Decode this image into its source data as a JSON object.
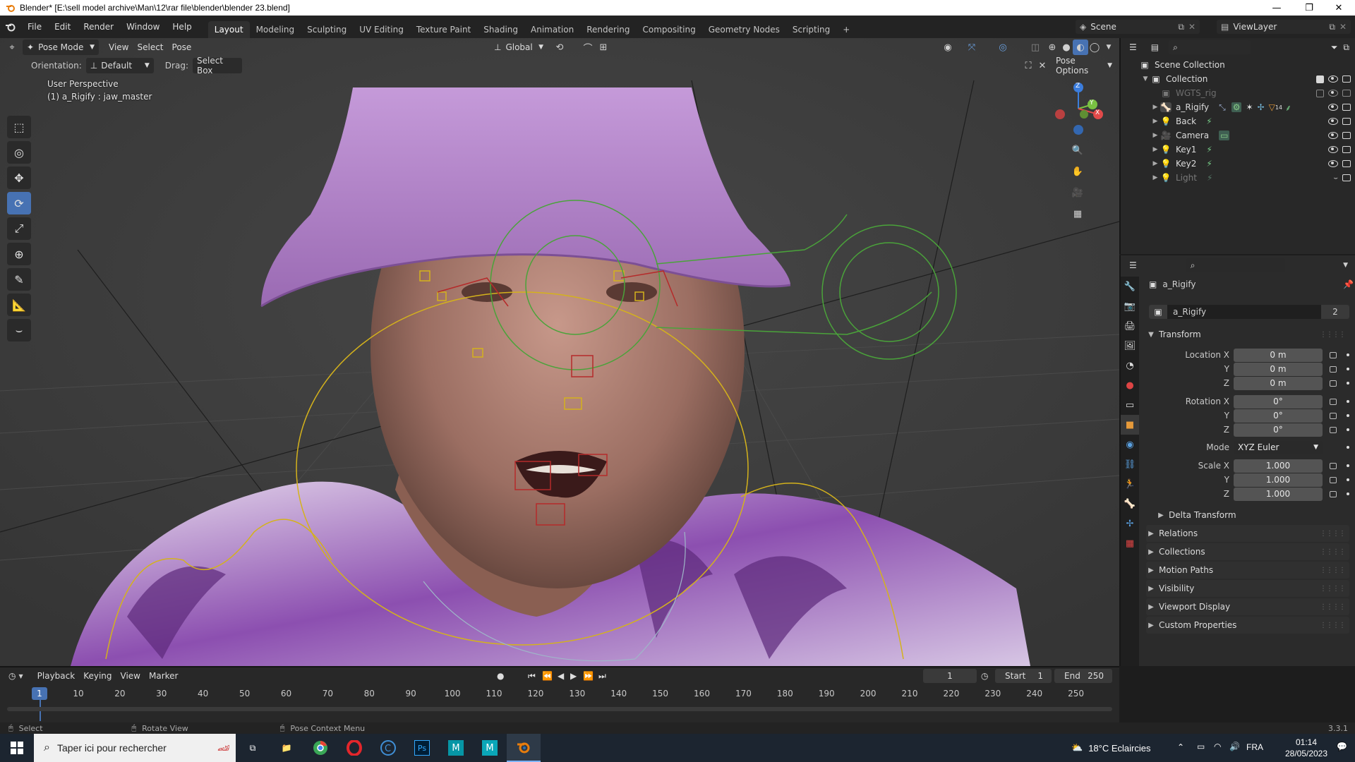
{
  "window": {
    "title": "Blender* [E:\\sell model archive\\Man\\12\\rar file\\blender\\blender 23.blend]",
    "minimize": "—",
    "maximize": "❐",
    "close": "✕"
  },
  "topbar": {
    "menus": [
      "File",
      "Edit",
      "Render",
      "Window",
      "Help"
    ],
    "workspaces": [
      "Layout",
      "Modeling",
      "Sculpting",
      "UV Editing",
      "Texture Paint",
      "Shading",
      "Animation",
      "Rendering",
      "Compositing",
      "Geometry Nodes",
      "Scripting"
    ],
    "active_workspace": "Layout",
    "add_tab": "+",
    "scene": "Scene",
    "view_layer": "ViewLayer"
  },
  "viewport_header": {
    "mode": "Pose Mode",
    "menus": [
      "View",
      "Select",
      "Pose"
    ],
    "transform_orientation": "Global",
    "orientation_label": "Orientation:",
    "orientation_value": "Default",
    "drag_label": "Drag:",
    "drag_value": "Select Box",
    "pose_options": "Pose Options"
  },
  "viewport": {
    "perspective": "User Perspective",
    "active_object": "(1) a_Rigify : jaw_master",
    "gizmo_axes": [
      "Z",
      "Y",
      "X"
    ]
  },
  "outliner": {
    "root": "Scene Collection",
    "collection": "Collection",
    "items": [
      {
        "name": "WGTS_rig",
        "dim": true
      },
      {
        "name": "a_Rigify",
        "dim": false
      },
      {
        "name": "Back",
        "dim": false
      },
      {
        "name": "Camera",
        "dim": false
      },
      {
        "name": "Key1",
        "dim": false
      },
      {
        "name": "Key2",
        "dim": false
      },
      {
        "name": "Light",
        "dim": true
      }
    ],
    "rigify_badge": "14"
  },
  "properties": {
    "object_name": "a_Rigify",
    "datablock_name": "a_Rigify",
    "user_count": "2",
    "transform_header": "Transform",
    "location_label": "Location X",
    "location": [
      "0 m",
      "0 m",
      "0 m"
    ],
    "rotation_label": "Rotation X",
    "rotation": [
      "0°",
      "0°",
      "0°"
    ],
    "mode_label": "Mode",
    "mode_value": "XYZ Euler",
    "scale_label": "Scale X",
    "scale": [
      "1.000",
      "1.000",
      "1.000"
    ],
    "axis_y": "Y",
    "axis_z": "Z",
    "delta_transform": "Delta Transform",
    "panels": [
      "Relations",
      "Collections",
      "Motion Paths",
      "Visibility",
      "Viewport Display",
      "Custom Properties"
    ]
  },
  "timeline": {
    "menus": [
      "Playback",
      "Keying",
      "View",
      "Marker"
    ],
    "current_frame": "1",
    "start_label": "Start",
    "start": "1",
    "end_label": "End",
    "end": "250",
    "ruler_marker": "1",
    "ruler_ticks": [
      "10",
      "20",
      "30",
      "40",
      "50",
      "60",
      "70",
      "80",
      "90",
      "100",
      "110",
      "120",
      "130",
      "140",
      "150",
      "160",
      "170",
      "180",
      "190",
      "200",
      "210",
      "220",
      "230",
      "240",
      "250"
    ]
  },
  "statusbar": {
    "select": "Select",
    "rotate": "Rotate View",
    "context": "Pose Context Menu",
    "version": "3.3.1"
  },
  "taskbar": {
    "search_placeholder": "Taper ici pour rechercher",
    "weather": "18°C  Eclaircies",
    "language": "FRA",
    "time": "01:14",
    "date": "28/05/2023"
  },
  "colors": {
    "accent": "#4772b3",
    "hat": "#b98ad0",
    "shirt": "#7a3f98",
    "bone_yellow": "#d4b21c",
    "bone_green": "#4aa33a",
    "bone_red": "#b52a2a"
  }
}
